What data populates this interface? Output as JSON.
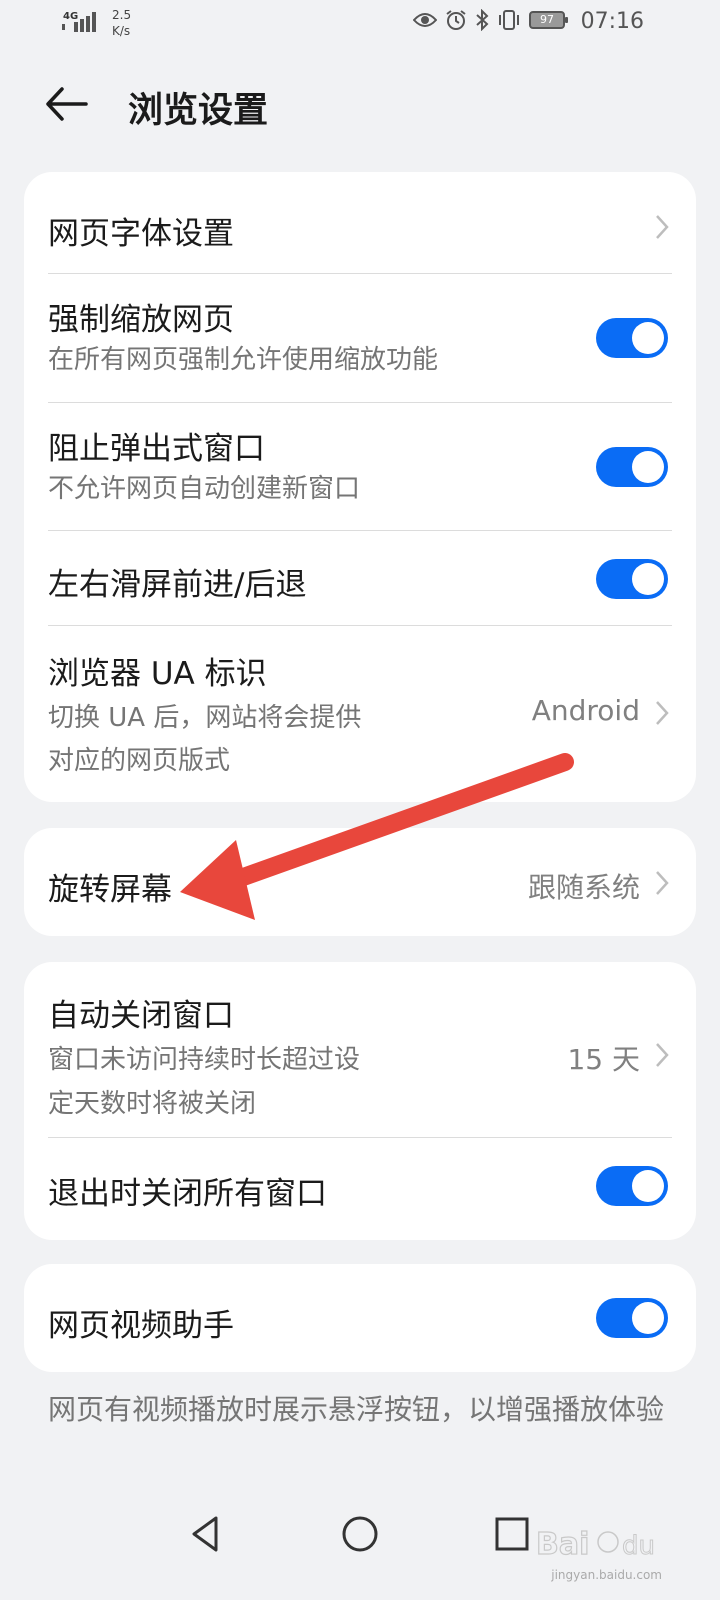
{
  "status_bar": {
    "network": "4G",
    "speed": "2.5\nK/s",
    "battery": "97",
    "time": "07:16",
    "icons": [
      "eye-icon",
      "alarm-icon",
      "bluetooth-icon",
      "vibrate-icon"
    ]
  },
  "header": {
    "title": "浏览设置",
    "back_icon": "back-arrow-icon"
  },
  "group1": {
    "font_settings": {
      "title": "网页字体设置"
    },
    "force_zoom": {
      "title": "强制缩放网页",
      "subtitle": "在所有网页强制允许使用缩放功能",
      "enabled": true
    },
    "block_popups": {
      "title": "阻止弹出式窗口",
      "subtitle": "不允许网页自动创建新窗口",
      "enabled": true
    },
    "swipe_nav": {
      "title": "左右滑屏前进/后退",
      "enabled": true
    },
    "ua": {
      "title": "浏览器 UA 标识",
      "subtitle_line1": "切换 UA 后，网站将会提供",
      "subtitle_line2": "对应的网页版式",
      "value": "Android"
    }
  },
  "group2": {
    "rotate": {
      "title": "旋转屏幕",
      "value": "跟随系统"
    }
  },
  "group3": {
    "auto_close": {
      "title": "自动关闭窗口",
      "subtitle_line1": "窗口未访问持续时长超过设",
      "subtitle_line2": "定天数时将被关闭",
      "value": "15 天"
    },
    "close_on_exit": {
      "title": "退出时关闭所有窗口",
      "enabled": true
    }
  },
  "group4": {
    "video_helper": {
      "title": "网页视频助手",
      "enabled": true
    }
  },
  "footnote": "网页有视频播放时展示悬浮按钮，以增强播放体验",
  "navbar": {
    "buttons": [
      "back-triangle-icon",
      "home-circle-icon",
      "recents-square-icon"
    ]
  },
  "watermark": {
    "text": "jingyan.baidu.com"
  },
  "colors": {
    "accent": "#0a6cf5",
    "background": "#f1f2f4",
    "annotation_arrow": "#e8473c"
  }
}
